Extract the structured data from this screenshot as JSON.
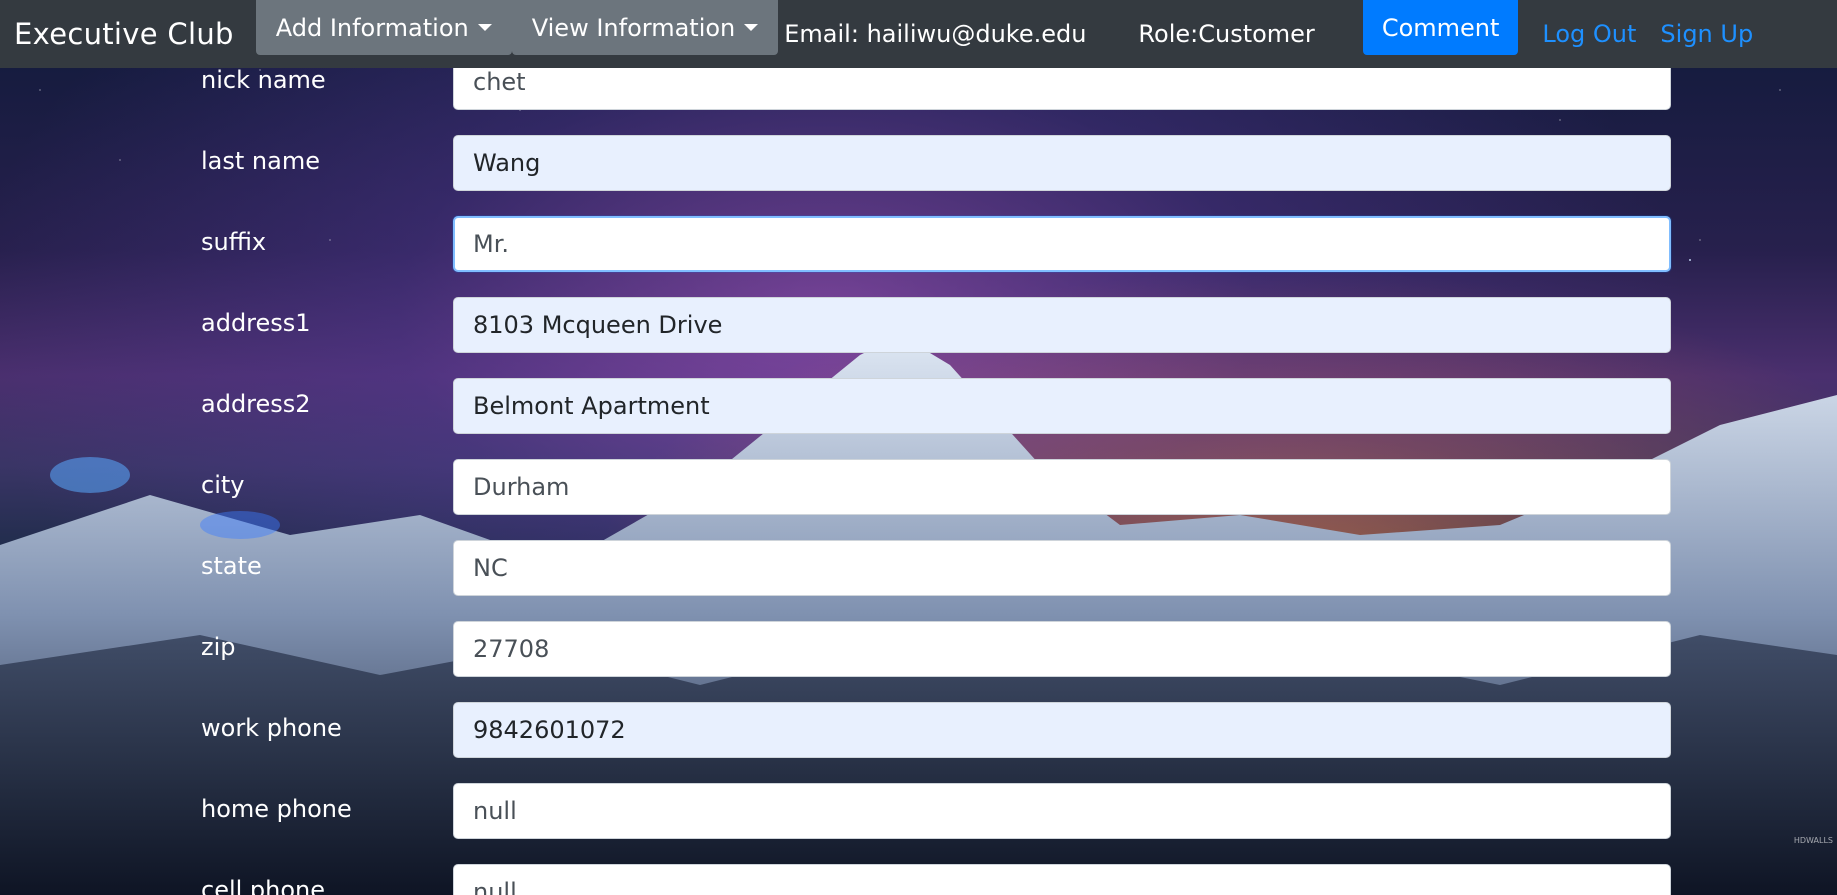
{
  "navbar": {
    "brand": "Executive Club",
    "add_information": "Add Information",
    "view_information": "View Information",
    "email": "Email: hailiwu@duke.edu",
    "role": "Role:Customer",
    "comment": "Comment",
    "log_out": "Log Out",
    "sign_up": "Sign Up"
  },
  "form": {
    "fields": [
      {
        "label": "nick name",
        "value": "chet"
      },
      {
        "label": "last name",
        "value": "Wang"
      },
      {
        "label": "suffix",
        "value": "Mr."
      },
      {
        "label": "address1",
        "value": "8103 Mcqueen Drive"
      },
      {
        "label": "address2",
        "value": "Belmont Apartment"
      },
      {
        "label": "city",
        "value": "Durham"
      },
      {
        "label": "state",
        "value": "NC"
      },
      {
        "label": "zip",
        "value": "27708"
      },
      {
        "label": "work phone",
        "value": "9842601072"
      },
      {
        "label": "home phone",
        "value": "null"
      },
      {
        "label": "cell phone",
        "value": "null"
      }
    ]
  },
  "colors": {
    "navbar_bg": "#343a40",
    "dropdown_bg": "#6c757d",
    "primary": "#007bff",
    "link": "#1e90ff",
    "autofill_bg": "#e8f0fe"
  },
  "background": {
    "watermark": "HDWALLS"
  }
}
